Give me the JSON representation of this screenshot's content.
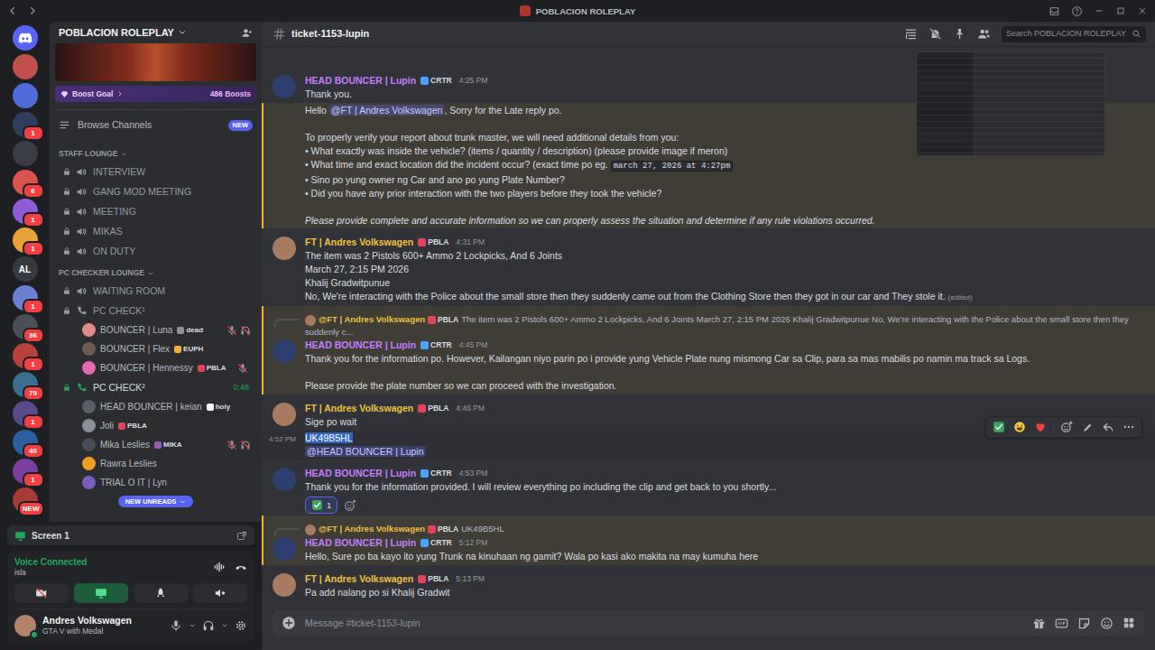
{
  "window": {
    "title": "POBLACION ROLEPLAY"
  },
  "rail": [
    {
      "kind": "home",
      "color": "#5865f2"
    },
    {
      "kind": "server",
      "color": "#c0504d"
    },
    {
      "kind": "server",
      "color": "#4f6bd8"
    },
    {
      "kind": "server",
      "badge": "1",
      "color": "#2f3e5c"
    },
    {
      "kind": "server",
      "color": "#3a3d44"
    },
    {
      "kind": "server",
      "badge": "6",
      "color": "#d9534f"
    },
    {
      "kind": "server",
      "badge": "1",
      "color": "#8e5bd6"
    },
    {
      "kind": "server",
      "badge": "1",
      "color": "#e8a23a"
    },
    {
      "kind": "text",
      "label": "AL",
      "color": "#36393f"
    },
    {
      "kind": "server",
      "badge": "1",
      "color": "#6b7fd1"
    },
    {
      "kind": "server",
      "badge": "36",
      "color": "#4a4e57"
    },
    {
      "kind": "server",
      "badge": "1",
      "color": "#b8403d"
    },
    {
      "kind": "server",
      "badge": "79",
      "color": "#3c6e8f"
    },
    {
      "kind": "server",
      "badge": "1",
      "color": "#5a4a8a"
    },
    {
      "kind": "server",
      "badge": "40",
      "color": "#2d5f9e"
    },
    {
      "kind": "server",
      "badge": "1",
      "color": "#7b3fa0"
    },
    {
      "kind": "server",
      "badge": "NEW",
      "color": "#a83a3a"
    }
  ],
  "server": {
    "name": "POBLACION ROLEPLAY",
    "boost_label": "Boost Goal",
    "boost_count": "486 Boosts",
    "browse_label": "Browse Channels",
    "browse_badge": "NEW"
  },
  "categories": [
    {
      "name": "STAFF LOUNGE",
      "expanded": true,
      "channels": [
        {
          "name": "INTERVIEW",
          "kind": "voice",
          "locked": true,
          "connected": false
        },
        {
          "name": "GANG MOD MEETING",
          "kind": "voice",
          "locked": true,
          "connected": false
        },
        {
          "name": "MEETING",
          "kind": "voice",
          "locked": true,
          "connected": false
        },
        {
          "name": "MIKAS",
          "kind": "voice",
          "locked": true,
          "connected": false
        },
        {
          "name": "ON DUTY",
          "kind": "voice",
          "locked": true,
          "connected": false
        }
      ]
    },
    {
      "name": "PC CHECKER LOUNGE",
      "expanded": true,
      "channels": [
        {
          "name": "WAITING ROOM",
          "kind": "voice",
          "locked": true,
          "connected": false
        },
        {
          "name": "PC CHECK¹",
          "kind": "call",
          "locked": true,
          "connected": false,
          "users": [
            {
              "name": "BOUNCER | Luna",
              "tag": "dead",
              "tag_color": "#8e9297",
              "avatar_color": "#e08a8a",
              "muted": true,
              "deafened": true
            },
            {
              "name": "BOUNCER | Flex",
              "tag": "EUPH",
              "tag_color": "#f0b232",
              "avatar_color": "#6d5c4f",
              "muted": false,
              "deafened": false
            },
            {
              "name": "BOUNCER | Hennessy",
              "tag": "PBLA",
              "tag_color": "#e0455a",
              "avatar_color": "#e86ab0",
              "muted": true,
              "deafened": false
            }
          ]
        },
        {
          "name": "PC CHECK²",
          "kind": "call",
          "locked": true,
          "connected": true,
          "timer": "0:48",
          "users": [
            {
              "name": "HEAD BOUNCER | keian",
              "tag": "holy",
              "tag_color": "#f5f5f5",
              "avatar_color": "#5b5e66",
              "muted": false,
              "deafened": false
            },
            {
              "name": "Joli",
              "tag": "PBLA",
              "tag_color": "#e0455a",
              "avatar_color": "#8a8f99",
              "muted": false,
              "deafened": false
            },
            {
              "name": "Mika Leslies",
              "tag": "MIKA",
              "tag_color": "#9b59b6",
              "avatar_color": "#4a4d55",
              "muted": true,
              "deafened": true
            },
            {
              "name": "Rawra Leslies",
              "avatar_color": "#f0a020",
              "muted": false,
              "deafened": false
            },
            {
              "name": "TRIAL O IT | Lyn",
              "avatar_color": "#7a5cc0",
              "muted": false,
              "deafened": false
            }
          ]
        }
      ]
    }
  ],
  "new_unreads": "NEW UNREADS",
  "voice": {
    "screen_label": "Screen 1",
    "status": "Voice Connected",
    "channel": "isla",
    "sharing": true
  },
  "user": {
    "name": "Andres Volkswagen",
    "activity": "GTA V with Medal",
    "online": true
  },
  "channel": {
    "name": "ticket-1153-lupin"
  },
  "search": {
    "placeholder": "Search POBLACION ROLEPLAY"
  },
  "composer": {
    "placeholder": "Message #ticket-1153-lupin"
  },
  "messages": [
    {
      "kind": "group",
      "author": "HEAD BOUNCER | Lupin",
      "name_color": "#c77dff",
      "avatar_color": "#2d3f6e",
      "tag": "CRTR",
      "tag_color": "#4aa3ff",
      "time": "4:25 PM",
      "highlighted": false,
      "hovered": false,
      "lines": [
        [
          {
            "kind": "plain",
            "text": "Thank you."
          }
        ]
      ]
    },
    {
      "kind": "continuation",
      "highlighted": true,
      "hovered": false,
      "lines": [
        [
          {
            "kind": "plain",
            "text": "Hello "
          },
          {
            "kind": "mention",
            "text": "@FT | Andres Volkswagen"
          },
          {
            "kind": "plain",
            "text": ", Sorry for the Late reply po."
          }
        ],
        [],
        [
          {
            "kind": "plain",
            "text": "To properly verify your report about trunk master, we will need additional details from you:"
          }
        ],
        [
          {
            "kind": "plain",
            "text": "• What exactly was inside the vehicle? (items / quantity / description) (please provide image if meron)"
          }
        ],
        [
          {
            "kind": "plain",
            "text": "• What time and exact location did the incident occur? (exact time po eg. "
          },
          {
            "kind": "code",
            "text": "march 27, 2026 at 4:27pm"
          }
        ],
        [
          {
            "kind": "plain",
            "text": "• Sino po yung owner ng Car and ano po yung Plate Number?"
          }
        ],
        [
          {
            "kind": "plain",
            "text": "• Did you have any prior interaction with the two players before they took the vehicle?"
          }
        ],
        [],
        [
          {
            "kind": "italic",
            "text": "Please provide complete and accurate information so we can properly assess the situation and determine if any rule violations occurred."
          }
        ]
      ]
    },
    {
      "kind": "group",
      "author": "FT | Andres Volkswagen",
      "name_color": "#f0c040",
      "avatar_color": "#a77b5f",
      "tag": "PBLA",
      "tag_color": "#e0455a",
      "time": "4:31 PM",
      "highlighted": false,
      "hovered": false,
      "lines": [
        [
          {
            "kind": "plain",
            "text": "The item was 2 Pistols 600+ Ammo 2 Lockpicks, And 6 Joints"
          }
        ],
        [
          {
            "kind": "plain",
            "text": "March 27, 2:15 PM 2026"
          }
        ],
        [
          {
            "kind": "plain",
            "text": "Khalij Gradwitpunue"
          }
        ],
        [
          {
            "kind": "plain",
            "text": "No, We're interacting with the Police about the small store then they suddenly came out from the Clothing Store then they got in our car and They stole it."
          },
          {
            "kind": "edited",
            "text": "(edited)"
          }
        ]
      ]
    },
    {
      "kind": "group",
      "author": "HEAD BOUNCER | Lupin",
      "name_color": "#c77dff",
      "avatar_color": "#2d3f6e",
      "tag": "CRTR",
      "tag_color": "#4aa3ff",
      "time": "4:45 PM",
      "highlighted": true,
      "hovered": false,
      "reply": {
        "author": "@FT | Andres Volkswagen",
        "name_color": "#f0c040",
        "avatar_color": "#a77b5f",
        "tag": "PBLA",
        "tag_color": "#e0455a",
        "text": "The item was 2 Pistols 600+ Ammo 2 Lockpicks, And 6 Joints March 27, 2:15 PM 2026 Khalij Gradwitpunue No, We're interacting with the Police about the small store then they suddenly c..."
      },
      "lines": [
        [
          {
            "kind": "plain",
            "text": "Thank you for the information po. However, Kailangan niyo parin po i provide yung Vehicle Plate nung mismong Car sa Clip, para sa mas mabilis po namin ma track sa Logs."
          }
        ],
        [],
        [
          {
            "kind": "plain",
            "text": "Please provide the plate number so we can proceed with the investigation."
          }
        ]
      ]
    },
    {
      "kind": "group",
      "author": "FT | Andres Volkswagen",
      "name_color": "#f0c040",
      "avatar_color": "#a77b5f",
      "tag": "PBLA",
      "tag_color": "#e0455a",
      "time": "4:46 PM",
      "highlighted": false,
      "hovered": false,
      "lines": [
        [
          {
            "kind": "plain",
            "text": "Sige po wait"
          }
        ]
      ]
    },
    {
      "kind": "continuation",
      "time": "4:52 PM",
      "highlighted": false,
      "hovered": true,
      "lines": [
        [
          {
            "kind": "selected",
            "text": "UK49B5HL"
          }
        ],
        [
          {
            "kind": "mention",
            "text": "@HEAD BOUNCER | Lupin"
          }
        ]
      ]
    },
    {
      "kind": "group",
      "author": "HEAD BOUNCER | Lupin",
      "name_color": "#c77dff",
      "avatar_color": "#2d3f6e",
      "tag": "CRTR",
      "tag_color": "#4aa3ff",
      "time": "4:53 PM",
      "highlighted": false,
      "hovered": false,
      "lines": [
        [
          {
            "kind": "plain",
            "text": "Thank you for the information provided. I will review everything po including the clip and get back to you shortly..."
          }
        ]
      ],
      "reactions": [
        {
          "count": "1",
          "selected": true
        }
      ]
    },
    {
      "kind": "group",
      "author": "HEAD BOUNCER | Lupin",
      "name_color": "#c77dff",
      "avatar_color": "#2d3f6e",
      "tag": "CRTR",
      "tag_color": "#4aa3ff",
      "time": "5:12 PM",
      "highlighted": true,
      "hovered": false,
      "reply": {
        "author": "@FT | Andres Volkswagen",
        "name_color": "#f0c040",
        "avatar_color": "#a77b5f",
        "tag": "PBLA",
        "tag_color": "#e0455a",
        "text": "UK49B5HL"
      },
      "lines": [
        [
          {
            "kind": "plain",
            "text": "Hello, Sure po ba kayo ito yung Trunk na kinuhaan ng gamit? Wala po kasi ako makita na may kumuha here"
          }
        ]
      ]
    },
    {
      "kind": "group",
      "author": "FT | Andres Volkswagen",
      "name_color": "#f0c040",
      "avatar_color": "#a77b5f",
      "tag": "PBLA",
      "tag_color": "#e0455a",
      "time": "5:13 PM",
      "highlighted": false,
      "hovered": false,
      "lines": [
        [
          {
            "kind": "plain",
            "text": "Pa add nalang po si Khalij Gradwit"
          }
        ]
      ]
    }
  ]
}
